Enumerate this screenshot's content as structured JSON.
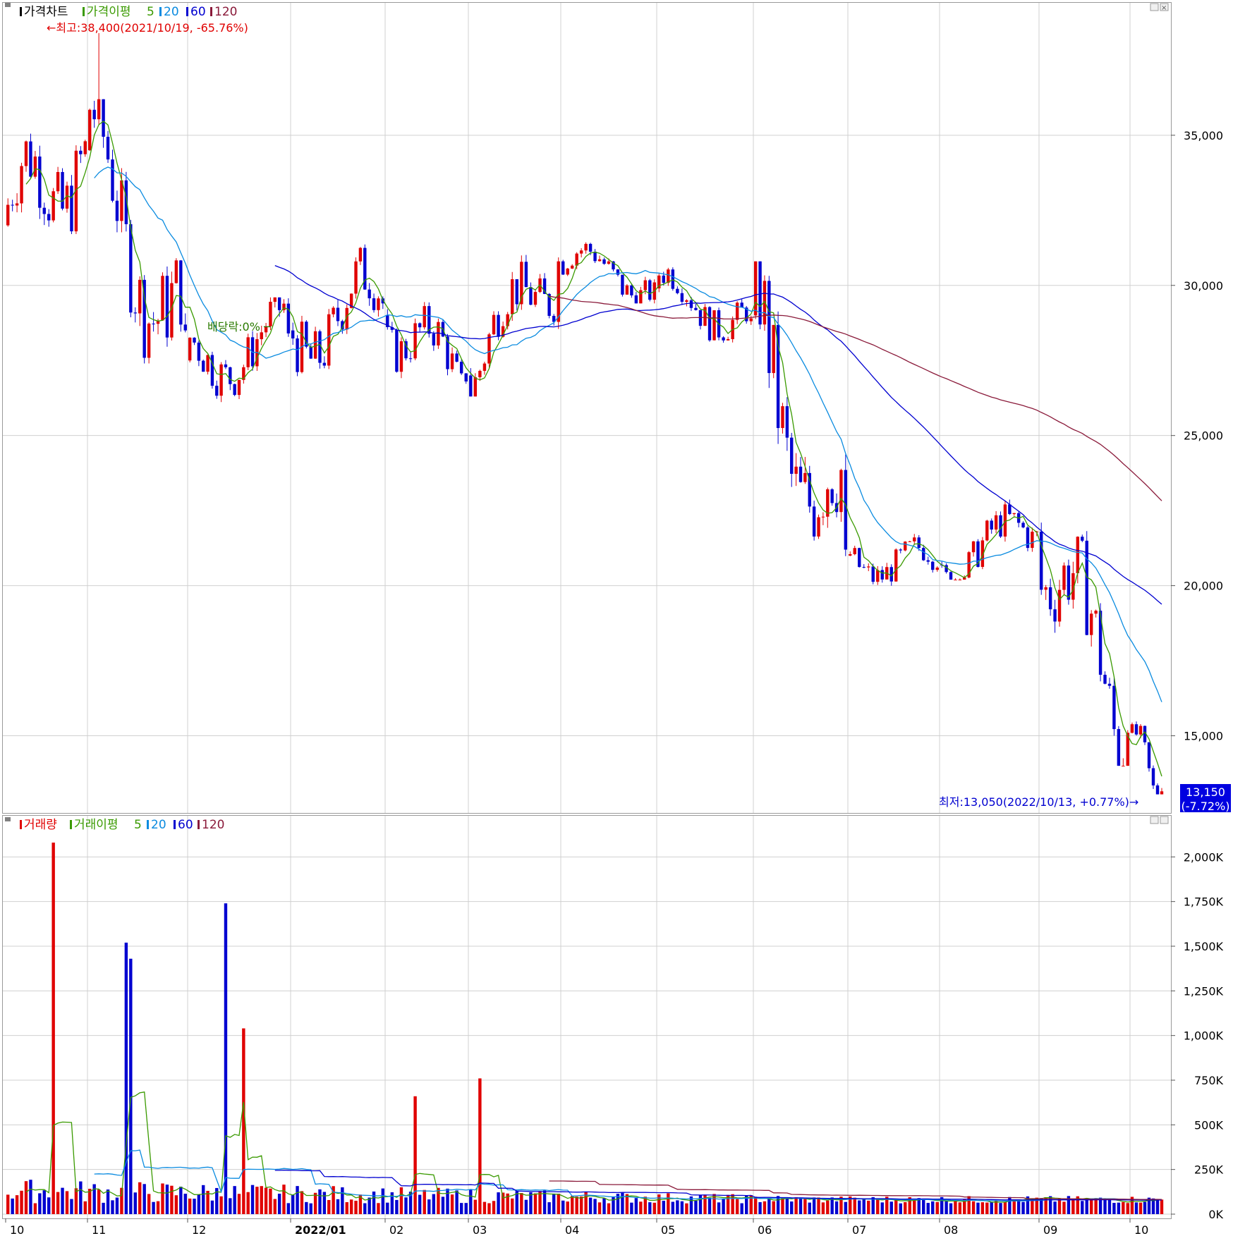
{
  "price_panel": {
    "legend": [
      {
        "label": "가격차트",
        "color": "#000000"
      },
      {
        "label": "가격이평",
        "color": "#3a9a00"
      },
      {
        "label": "5",
        "color": "#3a9a00"
      },
      {
        "label": "20",
        "color": "#0a8be0"
      },
      {
        "label": "60",
        "color": "#0000d0"
      },
      {
        "label": "120",
        "color": "#8a1a3a"
      }
    ],
    "high_annotation": "←최고:38,400(2021/10/19, -65.76%)",
    "low_annotation": "최저:13,050(2022/10/13, +0.77%)→",
    "dividend_annotation": "배당락:0% ─",
    "last_price": "13,150",
    "last_change": "(-7.72%)",
    "y_ticks": [
      "35,000",
      "30,000",
      "25,000",
      "20,000",
      "15,000"
    ]
  },
  "volume_panel": {
    "legend": [
      {
        "label": "거래량",
        "color": "#e00000"
      },
      {
        "label": "거래이평",
        "color": "#3a9a00"
      },
      {
        "label": "5",
        "color": "#3a9a00"
      },
      {
        "label": "20",
        "color": "#0a8be0"
      },
      {
        "label": "60",
        "color": "#0000d0"
      },
      {
        "label": "120",
        "color": "#8a1a3a"
      }
    ],
    "y_ticks": [
      "2,000K",
      "1,750K",
      "1,500K",
      "1,250K",
      "1,000K",
      "750K",
      "500K",
      "250K",
      "0K"
    ]
  },
  "x_axis": {
    "labels": [
      "10",
      "11",
      "12",
      "2022/01",
      "02",
      "03",
      "04",
      "05",
      "06",
      "07",
      "08",
      "09",
      "10"
    ]
  },
  "colors": {
    "up": "#e00000",
    "down": "#0000d0",
    "grid": "#d0d0d0"
  },
  "chart_data": [
    {
      "type": "candlestick",
      "title": "가격차트",
      "x_range": [
        "2021-10",
        "2022-10"
      ],
      "ylim": [
        12500,
        38800
      ],
      "moving_averages": [
        5,
        20,
        60,
        120
      ],
      "monthly_summary": [
        {
          "month": "2021/10",
          "open": 32000,
          "high": 38400,
          "low": 30700,
          "close": 34800
        },
        {
          "month": "2021/11",
          "open": 34500,
          "high": 36200,
          "low": 27400,
          "close": 28500
        },
        {
          "month": "2021/12",
          "open": 27500,
          "high": 29600,
          "low": 25050,
          "close": 28400
        },
        {
          "month": "2022/01",
          "open": 28500,
          "high": 32700,
          "low": 26800,
          "close": 29400
        },
        {
          "month": "2022/02",
          "open": 29000,
          "high": 29800,
          "low": 25400,
          "close": 26800
        },
        {
          "month": "2022/03",
          "open": 27000,
          "high": 31300,
          "low": 26300,
          "close": 30800
        },
        {
          "month": "2022/04",
          "open": 30800,
          "high": 32300,
          "low": 29400,
          "close": 30100
        },
        {
          "month": "2022/05",
          "open": 29900,
          "high": 30700,
          "low": 27500,
          "close": 28900
        },
        {
          "month": "2022/06",
          "open": 29000,
          "high": 30800,
          "low": 20000,
          "close": 21200
        },
        {
          "month": "2022/07",
          "open": 21000,
          "high": 22500,
          "low": 19600,
          "close": 20600
        },
        {
          "month": "2022/08",
          "open": 20700,
          "high": 23700,
          "low": 20200,
          "close": 21800
        },
        {
          "month": "2022/09",
          "open": 21800,
          "high": 22100,
          "low": 14000,
          "close": 15100
        },
        {
          "month": "2022/10",
          "open": 15100,
          "high": 15600,
          "low": 13050,
          "close": 13150
        }
      ],
      "high_point": {
        "date": "2021/10/19",
        "value": 38400
      },
      "low_point": {
        "date": "2022/10/13",
        "value": 13050
      },
      "last": {
        "value": 13150,
        "change_pct": -7.72
      }
    },
    {
      "type": "bar",
      "title": "거래량",
      "unit": "K",
      "ylim": [
        0,
        2100000
      ],
      "moving_averages": [
        5,
        20,
        60,
        120
      ],
      "notable_peaks": [
        {
          "date": "2021/10/19",
          "value": 2080000
        },
        {
          "date": "2021/11/18",
          "value": 1520000
        },
        {
          "date": "2021/11/19",
          "value": 1430000
        },
        {
          "date": "2022/01/03",
          "value": 1740000
        },
        {
          "date": "2022/01/07",
          "value": 1040000
        },
        {
          "date": "2022/04/11",
          "value": 760000
        },
        {
          "date": "2022/03/21",
          "value": 660000
        }
      ]
    }
  ]
}
